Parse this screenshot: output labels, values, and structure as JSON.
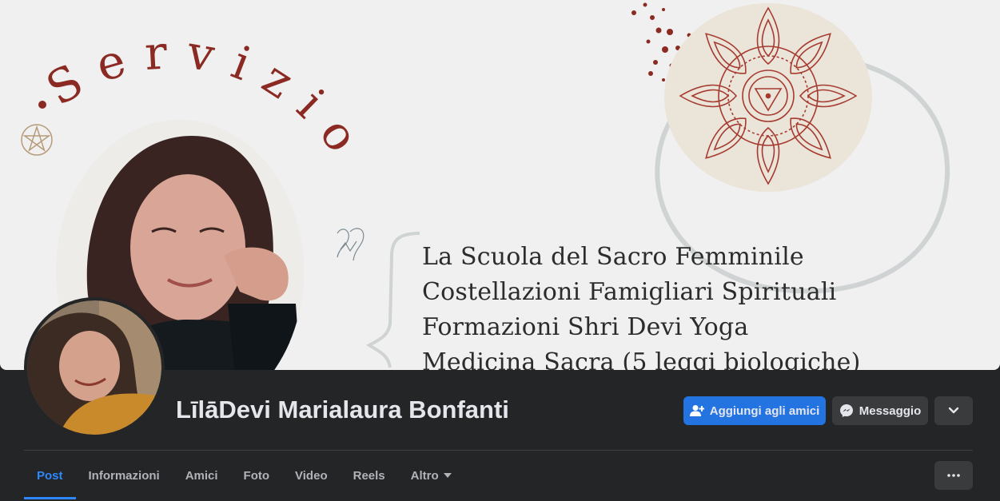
{
  "cover": {
    "arc_word": "Servizio",
    "lines": [
      "La Scuola del Sacro Femminile",
      "Costellazioni Famigliari Spirituali",
      "Formazioni Shri Devi Yoga",
      "Medicina Sacra (5 leggi biologiche)"
    ]
  },
  "profile": {
    "name": "LīlāDevi Marialaura Bonfanti"
  },
  "actions": {
    "add_friend": "Aggiungi agli amici",
    "message": "Messaggio"
  },
  "tabs": [
    {
      "label": "Post"
    },
    {
      "label": "Informazioni"
    },
    {
      "label": "Amici"
    },
    {
      "label": "Foto"
    },
    {
      "label": "Video"
    },
    {
      "label": "Reels"
    },
    {
      "label": "Altro"
    }
  ],
  "colors": {
    "accent": "#2374e1",
    "tab_active": "#2d88ff",
    "background": "#242526",
    "cover_red": "#8b2a22"
  }
}
